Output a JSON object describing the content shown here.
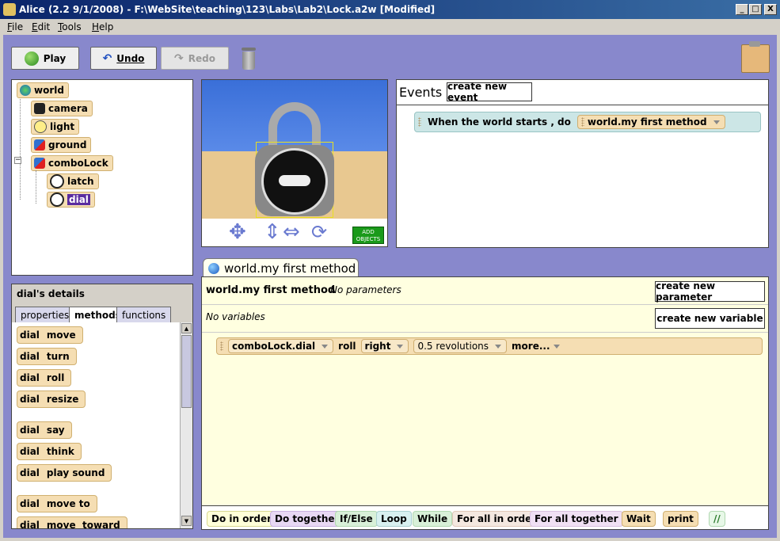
{
  "window": {
    "title": "Alice (2.2  9/1/2008) - F:\\WebSite\\teaching\\123\\Labs\\Lab2\\Lock.a2w [Modified]",
    "minimize": "_",
    "maximize": "□",
    "close": "X"
  },
  "menu": [
    "File",
    "Edit",
    "Tools",
    "Help"
  ],
  "toolbar": {
    "play": "Play",
    "undo": "Undo",
    "redo": "Redo"
  },
  "tree": {
    "world": "world",
    "items": [
      "camera",
      "light",
      "ground",
      "comboLock"
    ],
    "children": [
      "latch",
      "dial"
    ]
  },
  "scene": {
    "add_objects": "ADD\nOBJECTS"
  },
  "events": {
    "title": "Events",
    "create_button": "create new event",
    "event_text": "When the world starts ,  do",
    "event_method": "world.my first method"
  },
  "details": {
    "title": "dial's details",
    "tabs": [
      "properties",
      "methods",
      "functions"
    ],
    "object": "dial",
    "methods": [
      "move",
      "turn",
      "roll",
      "resize",
      "say",
      "think",
      "play sound",
      "move to",
      "move  toward"
    ]
  },
  "editor": {
    "tab_title": "world.my first method",
    "method_name": "world.my first method",
    "params": "No parameters",
    "vars": "No variables",
    "create_param": "create new parameter",
    "create_var": "create new variable",
    "statement": {
      "target": "comboLock.dial",
      "method": "roll",
      "direction": "right",
      "amount": "0.5 revolutions",
      "more": "more..."
    }
  },
  "controls": [
    "Do in order",
    "Do together",
    "If/Else",
    "Loop",
    "While",
    "For all in order",
    "For all together",
    "Wait",
    "print",
    "//"
  ],
  "colors": {
    "background": "#8888cc",
    "tile": "#f5deb3",
    "editor_bg": "#ffffe0",
    "event_bg": "#cce6e6",
    "selected": "#5a2ca0"
  }
}
